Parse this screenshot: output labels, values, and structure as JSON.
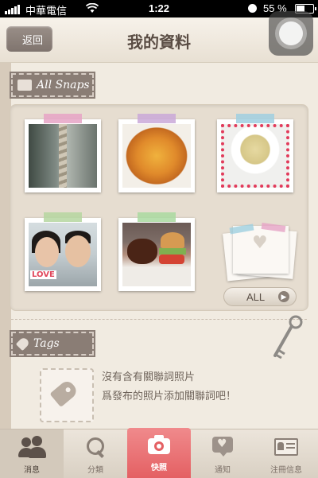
{
  "status_bar": {
    "carrier": "中華電信",
    "time": "1:22",
    "battery": "55 %",
    "battery_level": 0.55
  },
  "nav": {
    "back_label": "返回",
    "title": "我的資料"
  },
  "snaps": {
    "section_label": "All Snaps",
    "photos": [
      {
        "subject": "rope",
        "tape_color": "#e6a3c5"
      },
      {
        "subject": "pizza",
        "tape_color": "#c9a8d8"
      },
      {
        "subject": "soup",
        "tape_color": "#9fcfe0"
      },
      {
        "subject": "couple",
        "tape_color": "#b5d6a0",
        "overlay_text": "LOVE"
      },
      {
        "subject": "burger",
        "tape_color": "#a9d9a0"
      }
    ],
    "all_button": "ALL"
  },
  "tags": {
    "section_label": "Tags",
    "empty_line1": "沒有含有關聯詞照片",
    "empty_line2": "爲發布的照片添加關聯詞吧！"
  },
  "tabbar": {
    "items": [
      {
        "label": "消息",
        "icon": "people-icon",
        "selected": true
      },
      {
        "label": "分類",
        "icon": "search-icon"
      },
      {
        "label": "快照",
        "icon": "camera-icon",
        "highlighted": true
      },
      {
        "label": "通知",
        "icon": "heart-bubble-icon"
      },
      {
        "label": "注冊信息",
        "icon": "profile-card-icon"
      }
    ]
  },
  "colors": {
    "accent": "#e46063",
    "tag_brown": "#8a7d75",
    "background": "#f1ebe1"
  }
}
